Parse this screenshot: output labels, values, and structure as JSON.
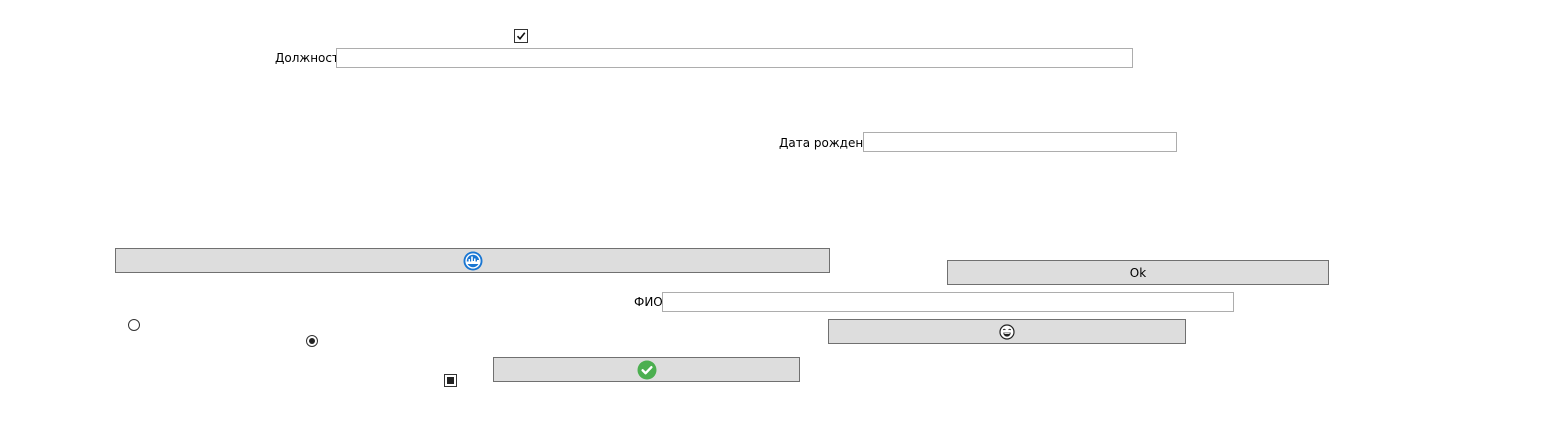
{
  "form": {
    "position_label": "Должность",
    "position_value": "",
    "birth_date_label": "Дата рождения",
    "birth_date_value": "",
    "fio_label": "ФИО",
    "fio_value": "",
    "ok_label": "Ok"
  },
  "checkboxes": {
    "top_checked": true,
    "bottom_state": "indeterminate"
  },
  "radios": {
    "first_selected": false,
    "second_selected": true
  },
  "icons": {
    "wide_button_icon": "city-skyline-badge-icon",
    "emoji_button_icon": "laughing-face-icon",
    "confirm_button_icon": "green-checkmark-icon"
  },
  "colors": {
    "button_face": "#dddddd",
    "button_border": "#707070",
    "input_border": "#adadad",
    "badge_blue": "#1976d2",
    "check_green": "#4caf50"
  }
}
